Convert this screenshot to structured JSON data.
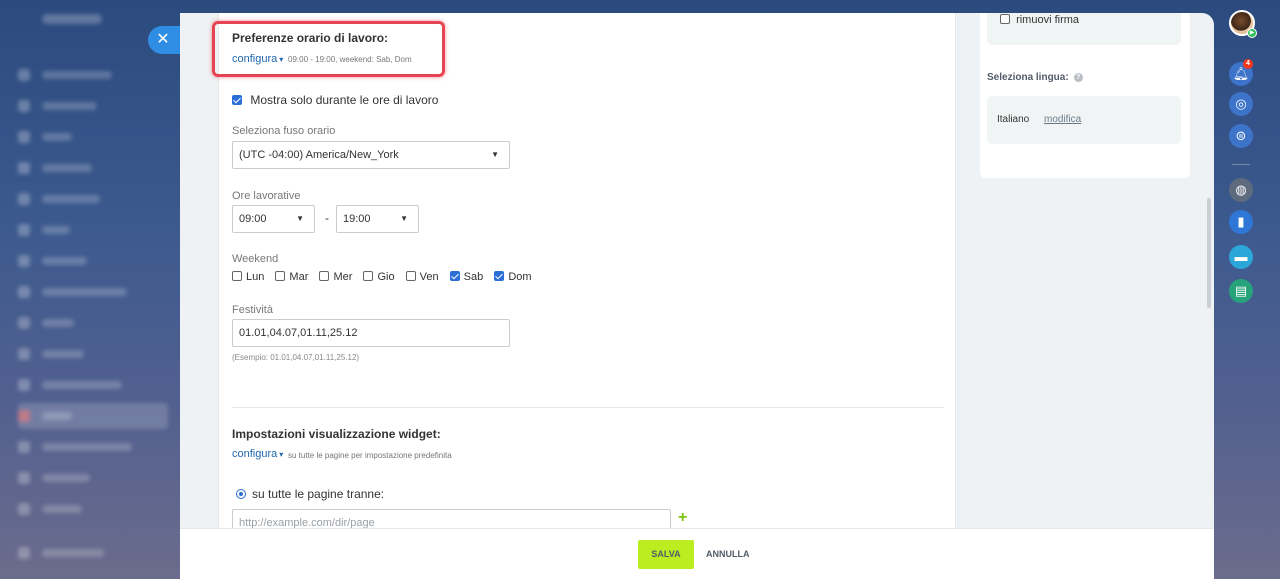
{
  "work_time": {
    "title": "Preferenze orario di lavoro:",
    "configure_label": "configura",
    "summary": "09:00 - 19:00, weekend: Sab, Dom",
    "show_only_working_hours_label": "Mostra solo durante le ore di lavoro",
    "show_only_working_hours_checked": true,
    "timezone_label": "Seleziona fuso orario",
    "timezone_value": "(UTC -04:00) America/New_York",
    "hours_label": "Ore lavorative",
    "hours_from": "09:00",
    "hours_separator": "-",
    "hours_to": "19:00",
    "weekend_label": "Weekend",
    "days": [
      {
        "label": "Lun",
        "checked": false
      },
      {
        "label": "Mar",
        "checked": false
      },
      {
        "label": "Mer",
        "checked": false
      },
      {
        "label": "Gio",
        "checked": false
      },
      {
        "label": "Ven",
        "checked": false
      },
      {
        "label": "Sab",
        "checked": true
      },
      {
        "label": "Dom",
        "checked": true
      }
    ],
    "holidays_label": "Festività",
    "holidays_value": "01.01,04.07,01.11,25.12",
    "holidays_example": "(Esempio: 01.01,04.07,01.11,25.12)"
  },
  "widget": {
    "title": "Impostazioni visualizzazione widget:",
    "configure_label": "configura",
    "summary": "su tutte le pagine per impostazione predefinita",
    "radio_label": "su tutte le pagine tranne:",
    "radio_selected": true,
    "url_placeholder": "http://example.com/dir/page"
  },
  "right_panel": {
    "remove_signature_label": "rimuovi firma",
    "remove_signature_checked": false,
    "language_title": "Seleziona lingua:",
    "language_value": "Italiano",
    "language_edit_label": "modifica"
  },
  "footer": {
    "save_label": "SALVA",
    "cancel_label": "ANNULLA"
  },
  "rail": {
    "notifications_count": "4"
  },
  "colors": {
    "accent_blue": "#2067b0",
    "save_green": "#bbed21",
    "highlight_red": "#e64452",
    "plus_green": "#7bc20e"
  }
}
